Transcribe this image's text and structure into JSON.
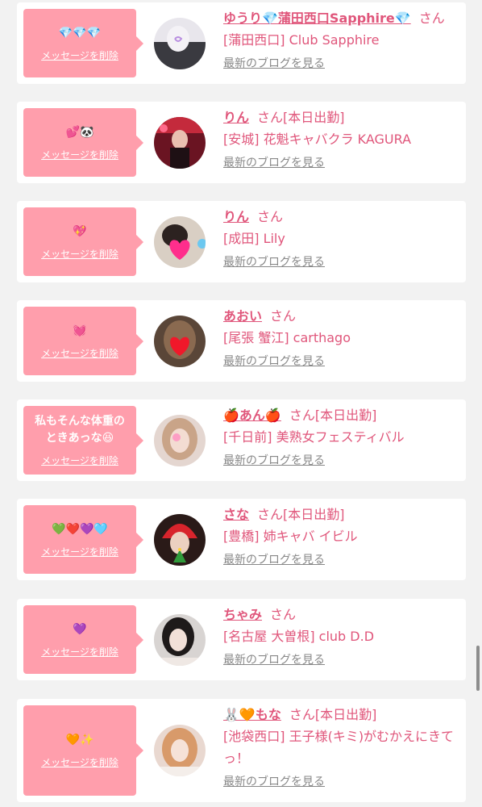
{
  "colors": {
    "bubble": "#ff9eac",
    "accent": "#e0567b",
    "link_gray": "#888888",
    "background": "#f2f2f2"
  },
  "messages": [
    {
      "bubble_text": "💎💎💎",
      "delete_label": "メッセージを削除",
      "name": "ゆうり💎蒲田西口Sapphire💎",
      "suffix": "さん",
      "shop": "[蒲田西口] Club Sapphire",
      "blog_label": "最新のブログを見る"
    },
    {
      "bubble_text": "💕🐼",
      "delete_label": "メッセージを削除",
      "name": "りん",
      "suffix": "さん[本日出勤]",
      "shop": "[安城] 花魁キャバクラ KAGURA",
      "blog_label": "最新のブログを見る"
    },
    {
      "bubble_text": "💖",
      "delete_label": "メッセージを削除",
      "name": "りん",
      "suffix": "さん",
      "shop": "[成田] Lily",
      "blog_label": "最新のブログを見る"
    },
    {
      "bubble_text": "💓",
      "delete_label": "メッセージを削除",
      "name": "あおい",
      "suffix": "さん",
      "shop": "[尾張 蟹江] carthago",
      "blog_label": "最新のブログを見る"
    },
    {
      "bubble_text": "私もそんな体重の\nときあっな😆",
      "delete_label": "メッセージを削除",
      "name": "🍎あん🍎",
      "suffix": "さん[本日出勤]",
      "shop": "[千日前] 美熟女フェスティバル",
      "blog_label": "最新のブログを見る"
    },
    {
      "bubble_text": "💚❤️💜🩵",
      "delete_label": "メッセージを削除",
      "name": "さな",
      "suffix": "さん[本日出勤]",
      "shop": "[豊橋] 姉キャバ イビル",
      "blog_label": "最新のブログを見る"
    },
    {
      "bubble_text": "💜",
      "delete_label": "メッセージを削除",
      "name": "ちゃみ",
      "suffix": "さん",
      "shop": "[名古屋 大曽根] club D.D",
      "blog_label": "最新のブログを見る"
    },
    {
      "bubble_text": "🧡✨",
      "delete_label": "メッセージを削除",
      "name": "🐰🧡もな",
      "suffix": "さん[本日出勤]",
      "shop": "[池袋西口] 王子様(キミ)がむかえにきてっ！",
      "blog_label": "最新のブログを見る"
    }
  ]
}
